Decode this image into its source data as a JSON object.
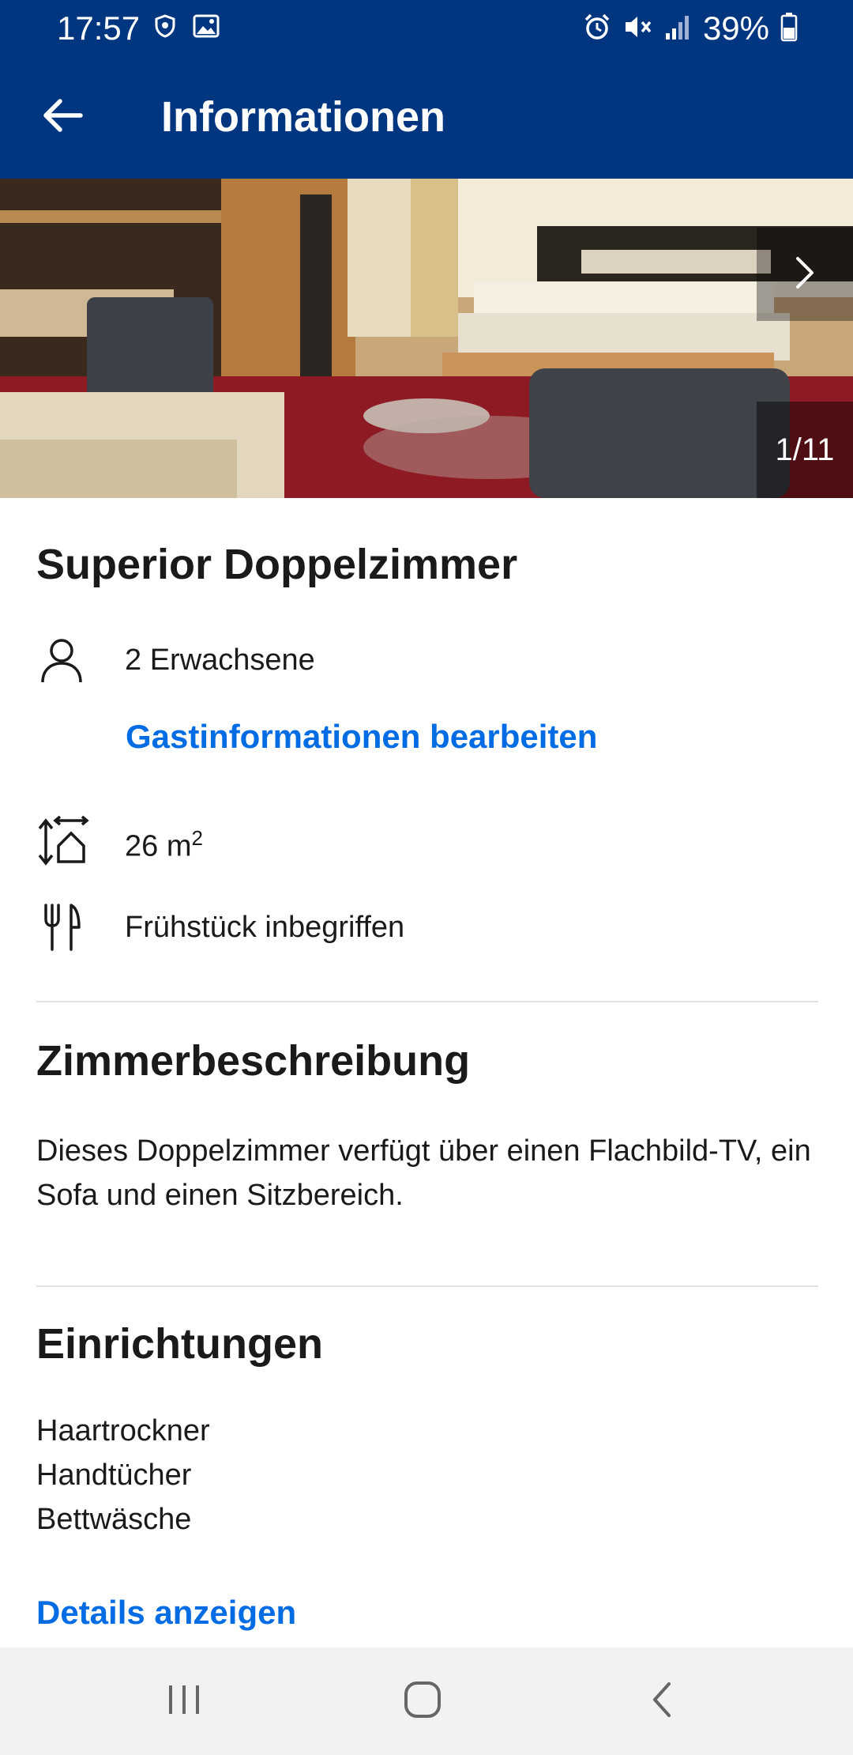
{
  "status_bar": {
    "time": "17:57",
    "battery": "39%",
    "left_icons": [
      "shield-icon",
      "image-icon"
    ],
    "right_icons": [
      "alarm-icon",
      "mute-icon",
      "signal-icon",
      "battery-icon"
    ]
  },
  "app_bar": {
    "title": "Informationen",
    "back_icon": "arrow-left-icon"
  },
  "gallery": {
    "counter": "1/11",
    "next_icon": "chevron-right-icon"
  },
  "room": {
    "title": "Superior Doppelzimmer",
    "guests": "2 Erwachsene",
    "edit_guests_link": "Gastinformationen bearbeiten",
    "size_value": "26 m",
    "size_exponent": "2",
    "meal": "Frühstück inbegriffen"
  },
  "description": {
    "heading": "Zimmerbeschreibung",
    "text": "Dieses Doppelzimmer verfügt über einen Flachbild-TV, ein Sofa und einen Sitzbereich."
  },
  "facilities": {
    "heading": "Einrichtungen",
    "items": [
      "Haartrockner",
      "Handtücher",
      "Bettwäsche"
    ],
    "details_link": "Details anzeigen"
  },
  "colors": {
    "brand_blue": "#003580",
    "link_blue": "#006ce4"
  }
}
